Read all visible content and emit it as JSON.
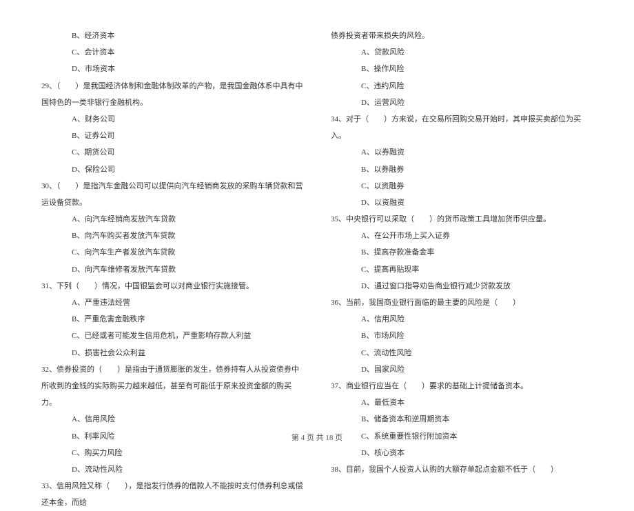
{
  "left": {
    "opt_b_28": "B、经济资本",
    "opt_c_28": "C、会计资本",
    "opt_d_28": "D、市场资本",
    "q29": "29、（　　）是我国经济体制和金融体制改革的产物，是我国金融体系中具有中国特色的一类非银行金融机构。",
    "q29_a": "A、财务公司",
    "q29_b": "B、证券公司",
    "q29_c": "C、期货公司",
    "q29_d": "D、保险公司",
    "q30": "30、（　　）是指汽车金融公司可以提供向汽车经销商发放的采购车辆贷款和营运设备贷款。",
    "q30_a": "A、向汽车经销商发放汽车贷款",
    "q30_b": "B、向汽车购买者发放汽车贷款",
    "q30_c": "C、向汽车生产者发放汽车贷款",
    "q30_d": "D、向汽车维修者发放汽车贷款",
    "q31": "31、下列（　　）情况，中国银监会可以对商业银行实施接管。",
    "q31_a": "A、严重违法经营",
    "q31_b": "B、严重危害金融秩序",
    "q31_c": "C、已经或者可能发生信用危机，严重影响存款人利益",
    "q31_d": "D、损害社会公众利益",
    "q32": "32、债券投资的（　　）是指由于通货膨胀的发生，债券持有人从投资债券中所收到的金钱的实际购买力越来越低，甚至有可能低于原来投资金额的购买力。",
    "q32_a": "A、信用风险",
    "q32_b": "B、利率风险",
    "q32_c": "C、购买力风险",
    "q32_d": "D、流动性风险",
    "q33": "33、信用风险又称（　　），是指发行债券的借款人不能按时支付债券利息或偿还本金，而给"
  },
  "right": {
    "q33_cont": "债券投资者带来损失的风险。",
    "q33_a": "A、贷款风险",
    "q33_b": "B、操作风险",
    "q33_c": "C、违约风险",
    "q33_d": "D、运营风险",
    "q34": "34、对于（　　）方来说，在交易所回购交易开始时，其申报买卖部位为买入。",
    "q34_a": "A、以券融资",
    "q34_b": "B、以券融券",
    "q34_c": "C、以资融券",
    "q34_d": "D、以资融资",
    "q35": "35、中央银行可以采取（　　）的货币政策工具增加货币供应量。",
    "q35_a": "A、在公开市场上买入证券",
    "q35_b": "B、提高存款准备金率",
    "q35_c": "C、提高再贴现率",
    "q35_d": "D、通过窗口指导劝告商业银行减少贷款发放",
    "q36": "36、当前，我国商业银行面临的最主要的风险是（　　）",
    "q36_a": "A、信用风险",
    "q36_b": "B、市场风险",
    "q36_c": "C、流动性风险",
    "q36_d": "D、国家风险",
    "q37": "37、商业银行应当在（　　）要求的基础上计提储备资本。",
    "q37_a": "A、最低资本",
    "q37_b": "B、储备资本和逆周期资本",
    "q37_c": "C、系统重要性银行附加资本",
    "q37_d": "D、核心资本",
    "q38": "38、目前，我国个人投资人认购的大额存单起点金额不低于（　　）"
  },
  "footer": "第 4 页 共 18 页"
}
